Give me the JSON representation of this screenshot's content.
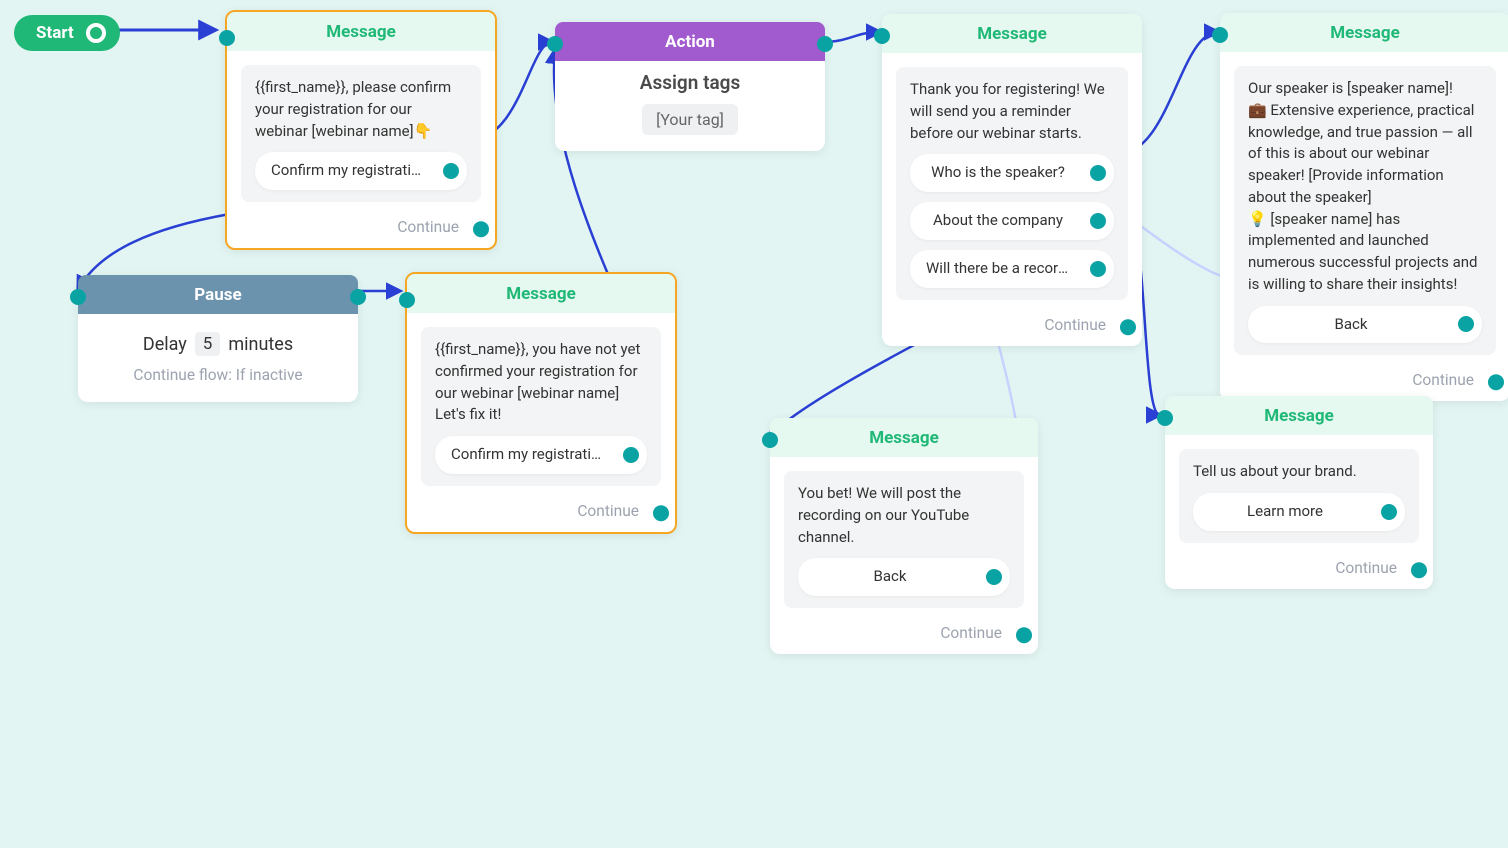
{
  "start": {
    "label": "Start"
  },
  "node1": {
    "header": "Message",
    "body": "{{first_name}}, please confirm your registration for our webinar [webinar name]👇",
    "button": "Confirm my registration ...",
    "continue": "Continue"
  },
  "node_action": {
    "header": "Action",
    "title": "Assign tags",
    "tag": "[Your tag]"
  },
  "node_pause": {
    "header": "Pause",
    "delay_word": "Delay",
    "delay_value": "5",
    "delay_unit": "minutes",
    "sub": "Continue flow: If inactive"
  },
  "node2": {
    "header": "Message",
    "body": "{{first_name}}, you have not yet confirmed your registration for our webinar [webinar name]\nLet's fix it!",
    "button": "Confirm my registration ...",
    "continue": "Continue"
  },
  "node_thanks": {
    "header": "Message",
    "body": "Thank you for registering! We will send you a reminder before our webinar starts.",
    "btn1": "Who is the speaker?",
    "btn2": "About the company",
    "btn3": "Will there be a recording?",
    "continue": "Continue"
  },
  "node_speaker": {
    "header": "Message",
    "body": "Our speaker is [speaker name]!\n💼  Extensive experience, practical knowledge, and true passion — all of this is about our webinar speaker! [Provide information about the speaker]\n💡  [speaker name] has implemented and launched numerous successful projects and is willing to share their insights!",
    "button": "Back",
    "continue": "Continue"
  },
  "node_record": {
    "header": "Message",
    "body": "You bet! We will post the recording on our YouTube channel.",
    "button": "Back",
    "continue": "Continue"
  },
  "node_brand": {
    "header": "Message",
    "body": "Tell us about your brand.",
    "button": "Learn more",
    "continue": "Continue"
  }
}
